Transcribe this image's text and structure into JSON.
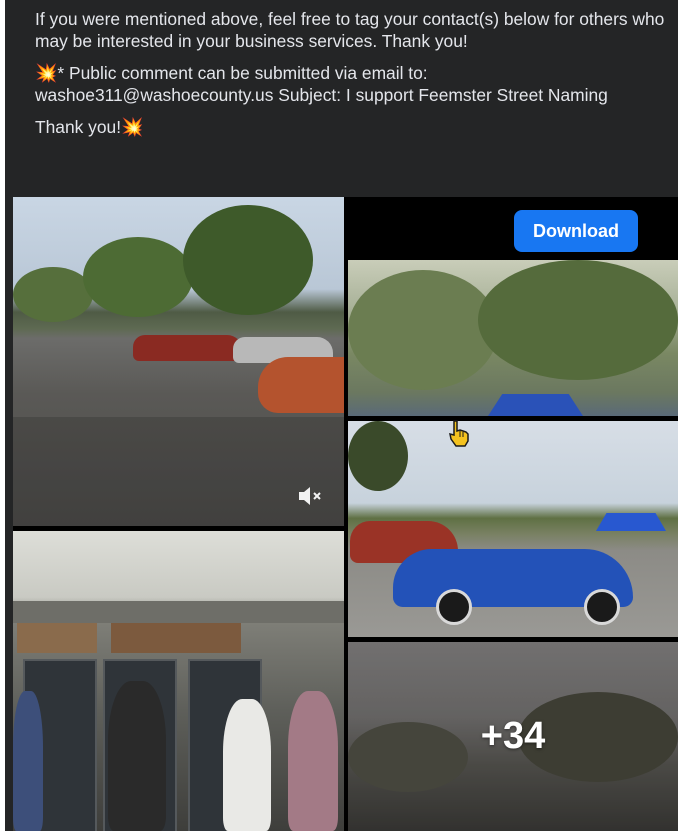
{
  "post": {
    "line1": "If you were mentioned above, feel free to tag your contact(s) below for others who may be interested in your business services. Thank you!",
    "public_comment_emoji": "💥",
    "public_comment": "* Public comment can be submitted via email to: washoe311@washoecounty.us Subject: I support Feemster Street Naming",
    "thank_you": "Thank you!",
    "thank_you_emoji": "💥"
  },
  "media": {
    "download_label": "Download",
    "more_count": "+34",
    "icons": {
      "video_muted": "speaker-muted-icon",
      "cursor": "hand-pointer-icon"
    },
    "photos": [
      "car-show-street-video",
      "live-band-performance",
      "trees-and-blue-tents",
      "blue-classic-car",
      "parking-lot-dusk"
    ]
  },
  "colors": {
    "background": "#242526",
    "text": "#e4e6eb",
    "accent": "#1877f2"
  }
}
